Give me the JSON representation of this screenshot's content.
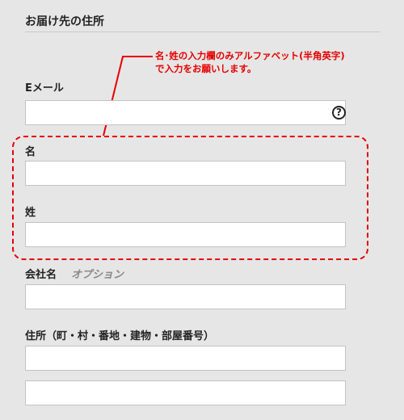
{
  "section": {
    "title": "お届け先の住所"
  },
  "annotation": {
    "line1": "名･姓の入力欄のみアルファベット(半角英字)",
    "line2": "で入力をお願いします。",
    "color": "#e60000"
  },
  "fields": {
    "email": {
      "label": "Eメール",
      "value": "",
      "help_icon": "question-circle-icon"
    },
    "first_name": {
      "label": "名",
      "value": ""
    },
    "last_name": {
      "label": "姓",
      "value": ""
    },
    "company": {
      "label": "会社名",
      "optional": "オプション",
      "value": ""
    },
    "address": {
      "label": "住所（町・村・番地・建物・部屋番号）",
      "line1_value": "",
      "line2_value": ""
    }
  },
  "help_glyph": "?"
}
